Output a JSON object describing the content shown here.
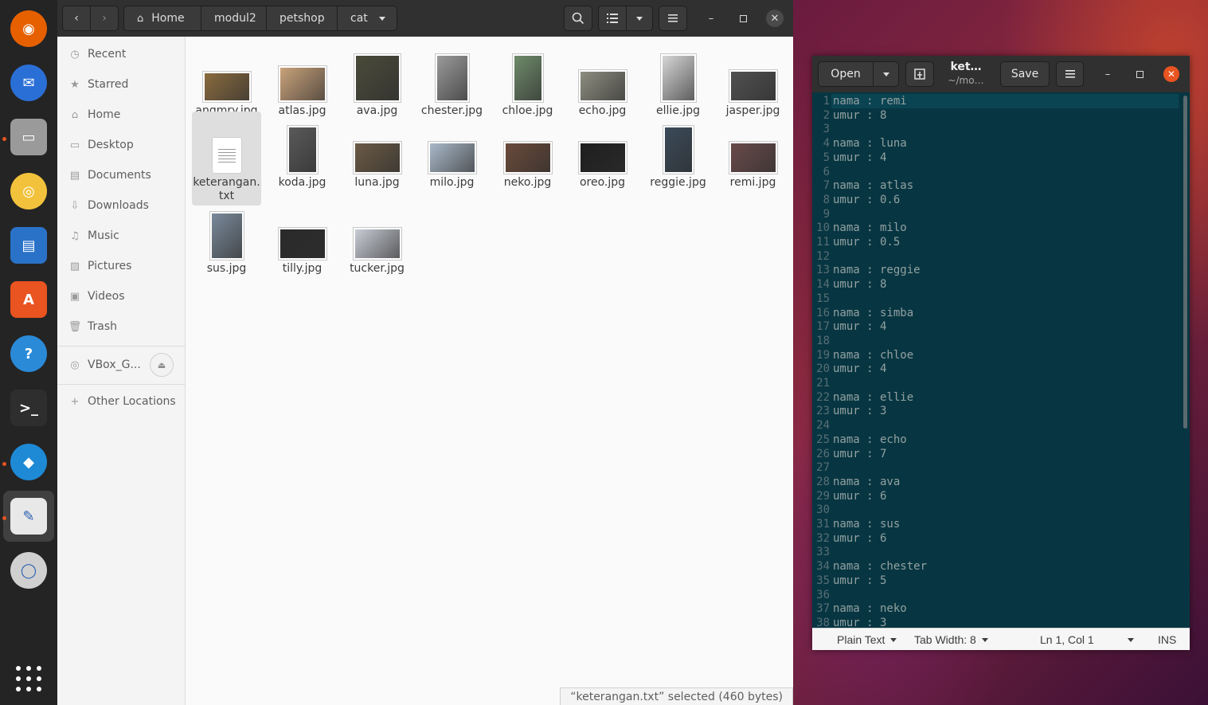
{
  "dock": {
    "apps": [
      "firefox-icon",
      "thunderbird-icon",
      "files-icon",
      "rhythmbox-icon",
      "writer-icon",
      "software-icon",
      "help-icon",
      "terminal-icon",
      "vscode-icon",
      "text-editor-icon",
      "dvd-icon"
    ],
    "show_apps": "show-apps-icon"
  },
  "files": {
    "breadcrumb": [
      "Home",
      "modul2",
      "petshop",
      "cat"
    ],
    "sidebar": [
      "Recent",
      "Starred",
      "Home",
      "Desktop",
      "Documents",
      "Downloads",
      "Music",
      "Pictures",
      "Videos",
      "Trash"
    ],
    "device": "VBox_G...",
    "other_locations": "Other Locations",
    "items": [
      {
        "name": "angmry.jpg",
        "color": "#8a6b3f"
      },
      {
        "name": "atlas.jpg",
        "color": "#c9a27a"
      },
      {
        "name": "ava.jpg",
        "color": "#4a4a3a"
      },
      {
        "name": "chester.jpg",
        "color": "#9a9a9a"
      },
      {
        "name": "chloe.jpg",
        "color": "#6e8a6a"
      },
      {
        "name": "echo.jpg",
        "color": "#8d8d80"
      },
      {
        "name": "ellie.jpg",
        "color": "#d6d6d6"
      },
      {
        "name": "jasper.jpg",
        "color": "#505050"
      },
      {
        "name": "keterangan.txt",
        "color": "#ffffff"
      },
      {
        "name": "koda.jpg",
        "color": "#5a5a5a"
      },
      {
        "name": "luna.jpg",
        "color": "#6b5a45"
      },
      {
        "name": "milo.jpg",
        "color": "#a9b8c8"
      },
      {
        "name": "neko.jpg",
        "color": "#6a4a3a"
      },
      {
        "name": "oreo.jpg",
        "color": "#1e1e1e"
      },
      {
        "name": "reggie.jpg",
        "color": "#3a4a5a"
      },
      {
        "name": "remi.jpg",
        "color": "#6a4a4a"
      },
      {
        "name": "sus.jpg",
        "color": "#7a8a9a"
      },
      {
        "name": "tilly.jpg",
        "color": "#2a2a2a"
      },
      {
        "name": "tucker.jpg",
        "color": "#c8ccd4"
      }
    ],
    "status": "“keterangan.txt” selected  (460 bytes)"
  },
  "editor": {
    "open_label": "Open",
    "title": "ket…",
    "subtitle": "~/mo…",
    "save_label": "Save",
    "lines": [
      "nama : remi",
      "umur : 8",
      "",
      "nama : luna",
      "umur : 4",
      "",
      "nama : atlas",
      "umur : 0.6",
      "",
      "nama : milo",
      "umur : 0.5",
      "",
      "nama : reggie",
      "umur : 8",
      "",
      "nama : simba",
      "umur : 4",
      "",
      "nama : chloe",
      "umur : 4",
      "",
      "nama : ellie",
      "umur : 3",
      "",
      "nama : echo",
      "umur : 7",
      "",
      "nama : ava",
      "umur : 6",
      "",
      "nama : sus",
      "umur : 6",
      "",
      "nama : chester",
      "umur : 5",
      "",
      "nama : neko",
      "umur : 3"
    ],
    "status": {
      "language": "Plain Text",
      "tab_width": "Tab Width: 8",
      "position": "Ln 1, Col 1",
      "mode": "INS"
    }
  }
}
